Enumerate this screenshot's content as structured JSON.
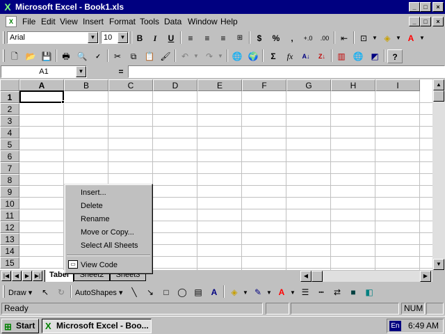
{
  "window": {
    "title": "Microsoft Excel - Book1.xls"
  },
  "window_buttons": {
    "minimize": "_",
    "maximize": "□",
    "close": "×"
  },
  "menu": {
    "items": [
      "File",
      "Edit",
      "View",
      "Insert",
      "Format",
      "Tools",
      "Data",
      "Window",
      "Help"
    ]
  },
  "formatting": {
    "font": "Arial",
    "size": "10",
    "bold": "B",
    "italic": "I",
    "underline": "U",
    "currency": "$",
    "percent": "%",
    "comma": ",",
    "inc_decimal": "+.0",
    "dec_decimal": ".00"
  },
  "standard": {
    "sum": "Σ",
    "fx": "fx",
    "help": "?"
  },
  "formula_bar": {
    "name_box": "A1",
    "equals": "=",
    "formula": ""
  },
  "grid": {
    "columns": [
      "A",
      "B",
      "C",
      "D",
      "E",
      "F",
      "G",
      "H",
      "I"
    ],
    "rows": [
      "1",
      "2",
      "3",
      "4",
      "5",
      "6",
      "7",
      "8",
      "9",
      "10",
      "11",
      "12",
      "13",
      "14",
      "15"
    ]
  },
  "sheets": {
    "tabs": [
      "Tabel",
      "Sheet2",
      "Sheet3"
    ],
    "active": "Tabel"
  },
  "context_menu": {
    "items": [
      "Insert...",
      "Delete",
      "Rename",
      "Move or Copy...",
      "Select All Sheets"
    ],
    "view_code": "View Code"
  },
  "drawing": {
    "draw": "Draw",
    "autoshapes": "AutoShapes"
  },
  "status": {
    "ready": "Ready",
    "num": "NUM"
  },
  "taskbar": {
    "start": "Start",
    "task": "Microsoft Excel - Boo...",
    "lang": "En",
    "clock": "6:49 AM"
  }
}
